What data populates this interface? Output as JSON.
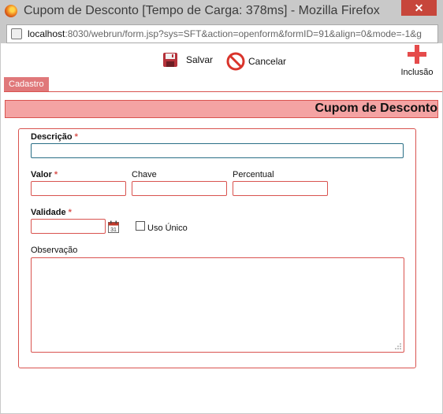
{
  "window": {
    "title": "Cupom de Desconto [Tempo de Carga: 378ms] - Mozilla Firefox",
    "close_glyph": "✕",
    "url_host": "localhost",
    "url_rest": ":8030/webrun/form.jsp?sys=SFT&action=openform&formID=91&align=0&mode=-1&g"
  },
  "toolbar": {
    "save_label": "Salvar",
    "cancel_label": "Cancelar",
    "add_label": "Inclusão"
  },
  "tabs": [
    {
      "label": "Cadastro"
    }
  ],
  "form": {
    "title": "Cupom de Desconto",
    "fields": {
      "descricao": {
        "label": "Descrição",
        "required_mark": "*",
        "value": ""
      },
      "valor": {
        "label": "Valor",
        "required_mark": "*",
        "value": ""
      },
      "chave": {
        "label": "Chave",
        "value": ""
      },
      "percentual": {
        "label": "Percentual",
        "value": ""
      },
      "validade": {
        "label": "Validade",
        "required_mark": "*",
        "value": ""
      },
      "uso_unico": {
        "label": "Uso Único",
        "checked": false
      },
      "observacao": {
        "label": "Observação",
        "value": ""
      }
    },
    "calendar_day": "31"
  },
  "colors": {
    "accent": "#d9534f",
    "header_bg": "#f4a3a3",
    "tab_bg": "#e0787a",
    "add_icon": "#e54b4b",
    "focus_border": "#2a6f86"
  },
  "icons": {
    "save": "floppy-disk-icon",
    "cancel": "no-entry-icon",
    "add": "plus-icon",
    "calendar": "calendar-icon"
  }
}
